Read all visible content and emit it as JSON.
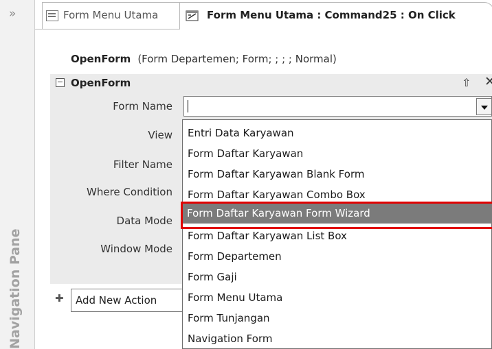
{
  "nav_pane": {
    "label": "Navigation Pane",
    "expand_glyph": "»"
  },
  "tabs": [
    {
      "label": "Form Menu Utama",
      "icon": "form-icon"
    },
    {
      "label": "Form Menu Utama : Command25 : On Click",
      "icon": "macro-icon"
    }
  ],
  "macro": {
    "summary_action": "OpenForm",
    "summary_args": "(Form Departemen; Form; ; ; ; Normal)",
    "action_title": "OpenForm",
    "collapse_glyph": "⊟",
    "move_up_glyph": "⇧",
    "close_glyph": "✕",
    "arguments": [
      {
        "label": "Form Name"
      },
      {
        "label": "View"
      },
      {
        "label": "Filter Name"
      },
      {
        "label": "Where Condition"
      },
      {
        "label": "Data Mode"
      },
      {
        "label": "Window Mode"
      }
    ],
    "form_name_value": ""
  },
  "dropdown": {
    "items": [
      "Entri Data Karyawan",
      "Form Daftar Karyawan",
      "Form Daftar Karyawan Blank Form",
      "Form Daftar Karyawan Combo Box",
      "Form Daftar Karyawan Form Wizard",
      "Form Daftar Karyawan List Box",
      "Form Departemen",
      "Form Gaji",
      "Form Menu Utama",
      "Form Tunjangan",
      "Navigation Form"
    ],
    "highlighted_index": 4
  },
  "add_action": {
    "plus_glyph": "✚",
    "placeholder": "Add New Action"
  },
  "colors": {
    "highlight": "#7b7b7b",
    "annotation": "#e00000",
    "action_bg": "#ebebeb"
  }
}
